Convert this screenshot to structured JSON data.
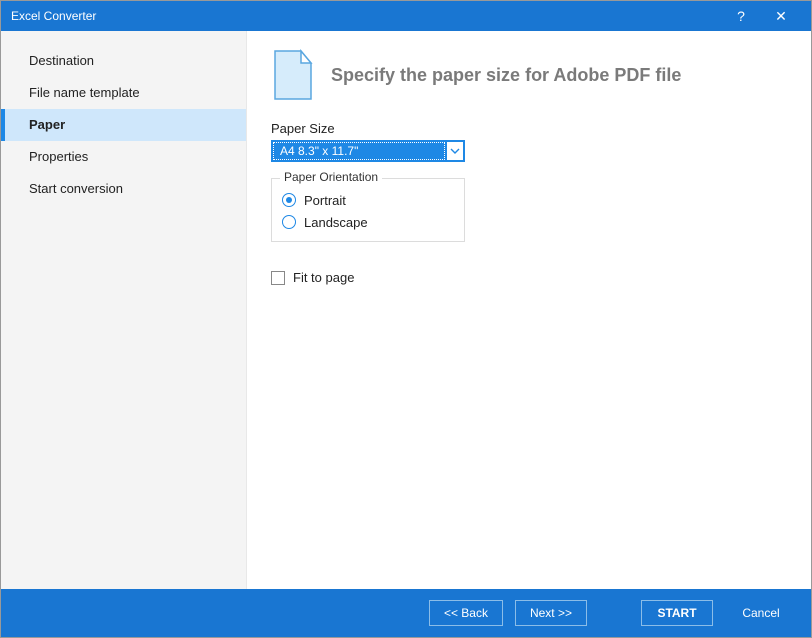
{
  "window": {
    "title": "Excel Converter"
  },
  "sidebar": {
    "items": [
      {
        "label": "Destination"
      },
      {
        "label": "File name template"
      },
      {
        "label": "Paper"
      },
      {
        "label": "Properties"
      },
      {
        "label": "Start conversion"
      }
    ],
    "active_index": 2
  },
  "content": {
    "heading": "Specify the paper size for Adobe PDF file",
    "paper_size_label": "Paper Size",
    "paper_size_value": "A4 8.3\" x 11.7\"",
    "orientation": {
      "legend": "Paper Orientation",
      "options": [
        {
          "label": "Portrait",
          "checked": true
        },
        {
          "label": "Landscape",
          "checked": false
        }
      ]
    },
    "fit_to_page": {
      "label": "Fit to page",
      "checked": false
    }
  },
  "footer": {
    "back": "<<  Back",
    "next": "Next  >>",
    "start": "START",
    "cancel": "Cancel"
  }
}
